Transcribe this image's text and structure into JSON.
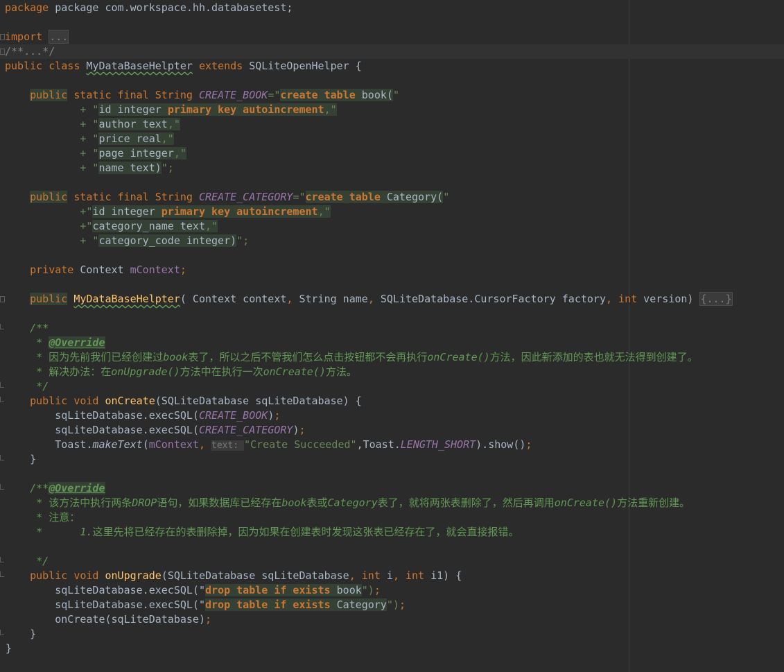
{
  "editor": {
    "lines": {
      "l01": "package com.workspace.hh.databasetest;",
      "l03_kw": "import",
      "l03_fold": "...",
      "l04": "/**...*/",
      "l05_kw1": "public class ",
      "l05_name": "MyDataBaseHelpter",
      "l05_kw2": " extends ",
      "l05_rest": "SQLiteOpenHelper {",
      "b_pub": "public",
      "b_mid": " static final String ",
      "b_const": "CREATE_BOOK",
      "b_eq": "=\"",
      "b_sql": "create table",
      "b_sqlrest": " book(",
      "b_q": "\"",
      "b1_pre": "        + \"",
      "b1_a": "id integer ",
      "b1_b": "primary key autoincrement",
      "b1_c": ",\"",
      "b2_pre": "        + \"",
      "b2_a": "author text",
      "b2_c": ",\"",
      "b3_pre": "        + \"",
      "b3_a": "price real",
      "b3_c": ",\"",
      "b4_pre": "        + \"",
      "b4_a": "page integer",
      "b4_c": ",\"",
      "b5_pre": "        + \"",
      "b5_a": "name text)",
      "b5_c": "\";",
      "c_pub": "public",
      "c_mid": " static final String ",
      "c_const": "CREATE_CATEGORY",
      "c_eq": "=\"",
      "c_sql": "create table",
      "c_sqlrest": " Category(",
      "c_q": "\"",
      "c1_pre": "        +\"",
      "c1_a": "id integer ",
      "c1_b": "primary key autoincrement",
      "c1_c": ",\"",
      "c2_pre": "        +\"",
      "c2_a": "category_name text",
      "c2_c": ",\"",
      "c3_pre": "        + \"",
      "c3_a": "category_code integer)",
      "c3_c": "\";",
      "ctx_kw": "private ",
      "ctx_type": "Context ",
      "ctx_field": "mContext",
      "ctx_semi": ";",
      "ctor_pub": "public",
      "ctor_name": "MyDataBaseHelpter",
      "ctor_a": "( Context context",
      "ctor_c1": ", ",
      "ctor_b": "String name",
      "ctor_c2": ", ",
      "ctor_cc": "SQLiteDatabase.CursorFactory factory",
      "ctor_c3": ", ",
      "ctor_int": "int",
      "ctor_ver": " version) ",
      "ctor_fold": "{...}",
      "d1_open": "/**",
      "d1_star": " * ",
      "d1_tag": "@Override",
      "d1_l3a": " * 因为先前我们已经创建过",
      "d1_l3b": "book",
      "d1_l3c": "表了，所以之后不管我们怎么点击按钮都不会再执行",
      "d1_l3d": "onCreate()",
      "d1_l3e": "方法，因此新添加的表也就无法得到创建了。",
      "d1_l4a": " * 解决办法：在",
      "d1_l4b": "onUpgrade()",
      "d1_l4c": "方法中在执行一次",
      "d1_l4d": "onCreate()",
      "d1_l4e": "方法。",
      "d1_close": " */",
      "oc_kw": "public void ",
      "oc_name": "onCreate",
      "oc_rest": "(SQLiteDatabase sqLiteDatabase) {",
      "oc1_a": "    sqLiteDatabase.execSQL(",
      "oc1_b": "CREATE_BOOK",
      "oc1_c": ")",
      "oc1_d": ";",
      "oc2_a": "    sqLiteDatabase.execSQL(",
      "oc2_b": "CREATE_CATEGORY",
      "oc2_c": ")",
      "oc2_d": ";",
      "oc3_a": "    Toast.",
      "oc3_b": "makeText",
      "oc3_c": "(",
      "oc3_d": "mContext",
      "oc3_e": ", ",
      "oc3_hint": "text: ",
      "oc3_f": "\"Create Succeeded\"",
      "oc3_g": ",Toast.",
      "oc3_h": "LENGTH_SHORT",
      "oc3_i": ").show()",
      "oc3_j": ";",
      "oc_end": "}",
      "d2_open": "/**",
      "d2_tag": "@Override",
      "d2_l2a": " * 该方法中执行两条",
      "d2_l2b": "DROP",
      "d2_l2c": "语句，如果数据库已经存在",
      "d2_l2d": "book",
      "d2_l2e": "表或",
      "d2_l2f": "Category",
      "d2_l2g": "表了，就将两张表删除了，然后再调用",
      "d2_l2h": "onCreate()",
      "d2_l2i": "方法重新创建。",
      "d2_l3": " * 注意：",
      "d2_l4a": " *      ",
      "d2_l4b": "1.",
      "d2_l4c": "这里先将已经存在的表删除掉，因为如果在创建表时发现这张表已经存在了，就会直接报错。",
      "d2_close": " */",
      "ou_kw": "public void ",
      "ou_name": "onUpgrade",
      "ou_a": "(SQLiteDatabase sqLiteDatabase",
      "ou_c1": ", ",
      "ou_int1": "int",
      "ou_b": " i",
      "ou_c2": ", ",
      "ou_int2": "int",
      "ou_c": " i1) {",
      "ou1_a": "    sqLiteDatabase.execSQL(\"",
      "ou1_b": "drop table if exists",
      "ou1_c": " book",
      "ou1_d": "\")",
      "ou1_e": ";",
      "ou2_a": "    sqLiteDatabase.execSQL(\"",
      "ou2_b": "drop table if exists",
      "ou2_c": " Category",
      "ou2_d": "\")",
      "ou2_e": ";",
      "ou3_a": "    onCreate(sqLiteDatabase)",
      "ou3_b": ";",
      "ou_end": "}",
      "cls_end": "}"
    }
  }
}
